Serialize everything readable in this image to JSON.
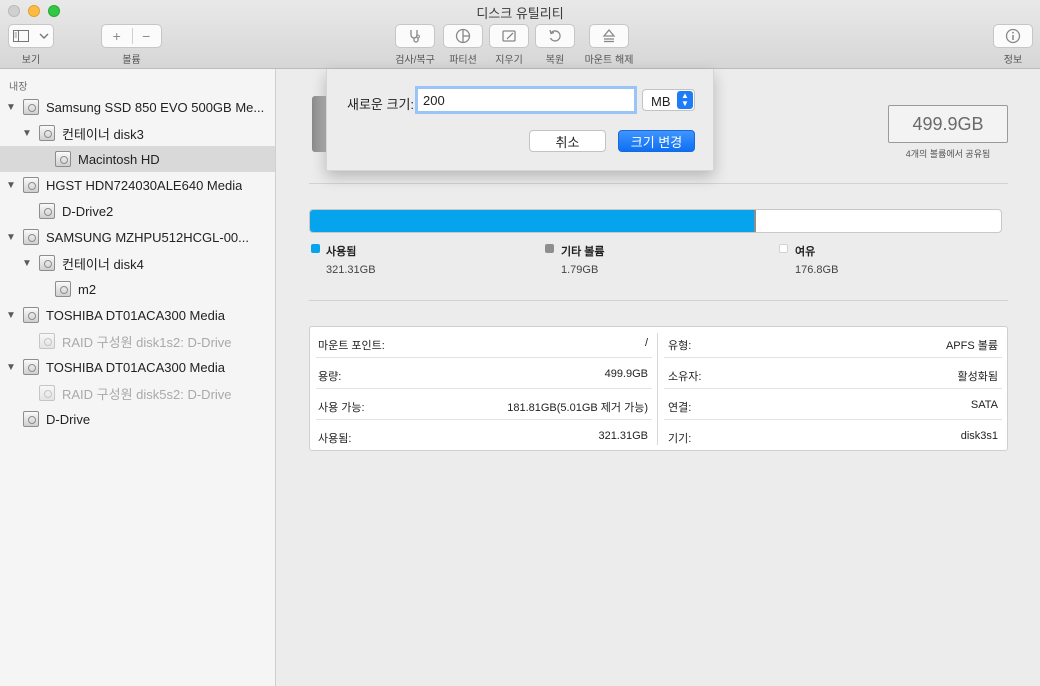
{
  "window": {
    "title": "디스크 유틸리티"
  },
  "toolbar": {
    "view_label": "보기",
    "volume_label": "볼륨",
    "volume_add": "+",
    "volume_remove": "−",
    "first_aid_label": "검사/복구",
    "partition_label": "파티션",
    "erase_label": "지우기",
    "restore_label": "복원",
    "unmount_label": "마운트 해제",
    "info_label": "정보"
  },
  "sidebar": {
    "header": "내장",
    "items": [
      {
        "label": "Samsung SSD 850 EVO 500GB Me...",
        "expanded": true,
        "dim": false
      },
      {
        "label": "컨테이너 disk3",
        "expanded": true,
        "dim": false
      },
      {
        "label": "Macintosh HD",
        "selected": true,
        "dim": false
      },
      {
        "label": "HGST HDN724030ALE640 Media",
        "expanded": true,
        "dim": false
      },
      {
        "label": "D-Drive2",
        "dim": false
      },
      {
        "label": "SAMSUNG MZHPU512HCGL-00...",
        "expanded": true,
        "dim": false
      },
      {
        "label": "컨테이너 disk4",
        "expanded": true,
        "dim": false
      },
      {
        "label": "m2",
        "dim": false
      },
      {
        "label": "TOSHIBA DT01ACA300 Media",
        "expanded": true,
        "dim": false
      },
      {
        "label": "RAID 구성원 disk1s2: D-Drive",
        "dim": true
      },
      {
        "label": "TOSHIBA DT01ACA300 Media",
        "expanded": true,
        "dim": false
      },
      {
        "label": "RAID 구성원 disk5s2: D-Drive",
        "dim": true
      },
      {
        "label": "D-Drive",
        "dim": false
      }
    ]
  },
  "volume": {
    "capacity": "499.9GB",
    "capacity_sub": "4개의 볼륨에서 공유됨"
  },
  "usage": {
    "used_fraction": 0.6427,
    "other_fraction": 0.0036,
    "legend": [
      {
        "name": "사용됨",
        "value": "321.31GB",
        "color": "#05a4ec"
      },
      {
        "name": "기타 볼륨",
        "value": "1.79GB",
        "color": "#8e8e8e"
      },
      {
        "name": "여유",
        "value": "176.8GB",
        "color": "#ffffff"
      }
    ]
  },
  "info": {
    "left": [
      {
        "label": "마운트 포인트:",
        "value": "/"
      },
      {
        "label": "용량:",
        "value": "499.9GB"
      },
      {
        "label": "사용 가능:",
        "value": "181.81GB(5.01GB 제거 가능)"
      },
      {
        "label": "사용됨:",
        "value": "321.31GB"
      }
    ],
    "right": [
      {
        "label": "유형:",
        "value": "APFS 볼륨"
      },
      {
        "label": "소유자:",
        "value": "활성화됨"
      },
      {
        "label": "연결:",
        "value": "SATA"
      },
      {
        "label": "기기:",
        "value": "disk3s1"
      }
    ]
  },
  "sheet": {
    "size_label": "새로운 크기:",
    "size_value": "200",
    "unit": "MB",
    "cancel": "취소",
    "apply": "크기 변경"
  }
}
